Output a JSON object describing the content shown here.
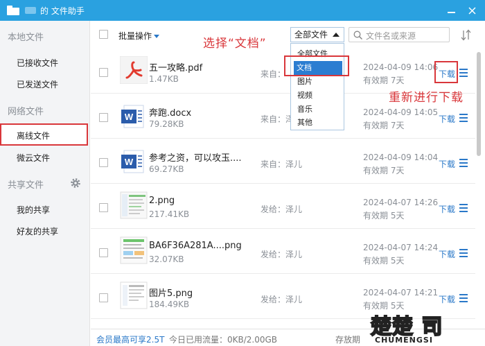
{
  "window": {
    "title": "的 文件助手"
  },
  "sidebar": {
    "groups": [
      {
        "label": "本地文件",
        "items": [
          "已接收文件",
          "已发送文件"
        ]
      },
      {
        "label": "网络文件",
        "items": [
          "离线文件",
          "微云文件"
        ]
      },
      {
        "label": "共享文件",
        "items": [
          "我的共享",
          "好友的共享"
        ]
      }
    ],
    "selected": "离线文件"
  },
  "toolbar": {
    "batch_label": "批量操作",
    "filter_value": "全部文件",
    "search_placeholder": "文件名或来源",
    "annotation_select": "选择“文档”"
  },
  "filter_dropdown": {
    "options": [
      "全部文件",
      "文档",
      "图片",
      "视频",
      "音乐",
      "其他"
    ],
    "selected": "文档"
  },
  "annotation_retry": "重新进行下载",
  "files": [
    {
      "name": "五一攻略.pdf",
      "size": "1.47KB",
      "source": "来自：",
      "date": "2024-04-09 14:06",
      "expiry": "有效期 7天",
      "action": "下载",
      "type": "pdf"
    },
    {
      "name": "奔跑.docx",
      "size": "79.28KB",
      "source": "来自：泽",
      "date": "2024-04-09 14:05",
      "expiry": "有效期 7天",
      "action": "下载",
      "type": "word"
    },
    {
      "name": "参考之资，可以攻玉....",
      "size": "69.27KB",
      "source": "来自：泽儿",
      "date": "2024-04-09 14:04",
      "expiry": "有效期 7天",
      "action": "下载",
      "type": "word"
    },
    {
      "name": "2.png",
      "size": "217.41KB",
      "source": "发给：泽儿",
      "date": "2024-04-07 14:26",
      "expiry": "有效期 5天",
      "action": "下载",
      "type": "image"
    },
    {
      "name": "BA6F36A281A....png",
      "size": "32.07KB",
      "source": "发给：泽儿",
      "date": "2024-04-07 14:24",
      "expiry": "有效期 5天",
      "action": "下载",
      "type": "image"
    },
    {
      "name": "图片5.png",
      "size": "184.49KB",
      "source": "发给：泽儿",
      "date": "2024-04-07 14:21",
      "expiry": "有效期 5天",
      "action": "下载",
      "type": "image"
    }
  ],
  "footer": {
    "vip": "会员最高可享2.5T",
    "usage": "今日已用流量：0KB/2.00GB",
    "store": "存放期"
  },
  "watermark": {
    "big": "楚楚 司",
    "small": "CHUMENGSI"
  },
  "colors": {
    "titlebar": "#2aa1e0",
    "accent": "#2a78c8",
    "annotation": "#d9363a"
  }
}
